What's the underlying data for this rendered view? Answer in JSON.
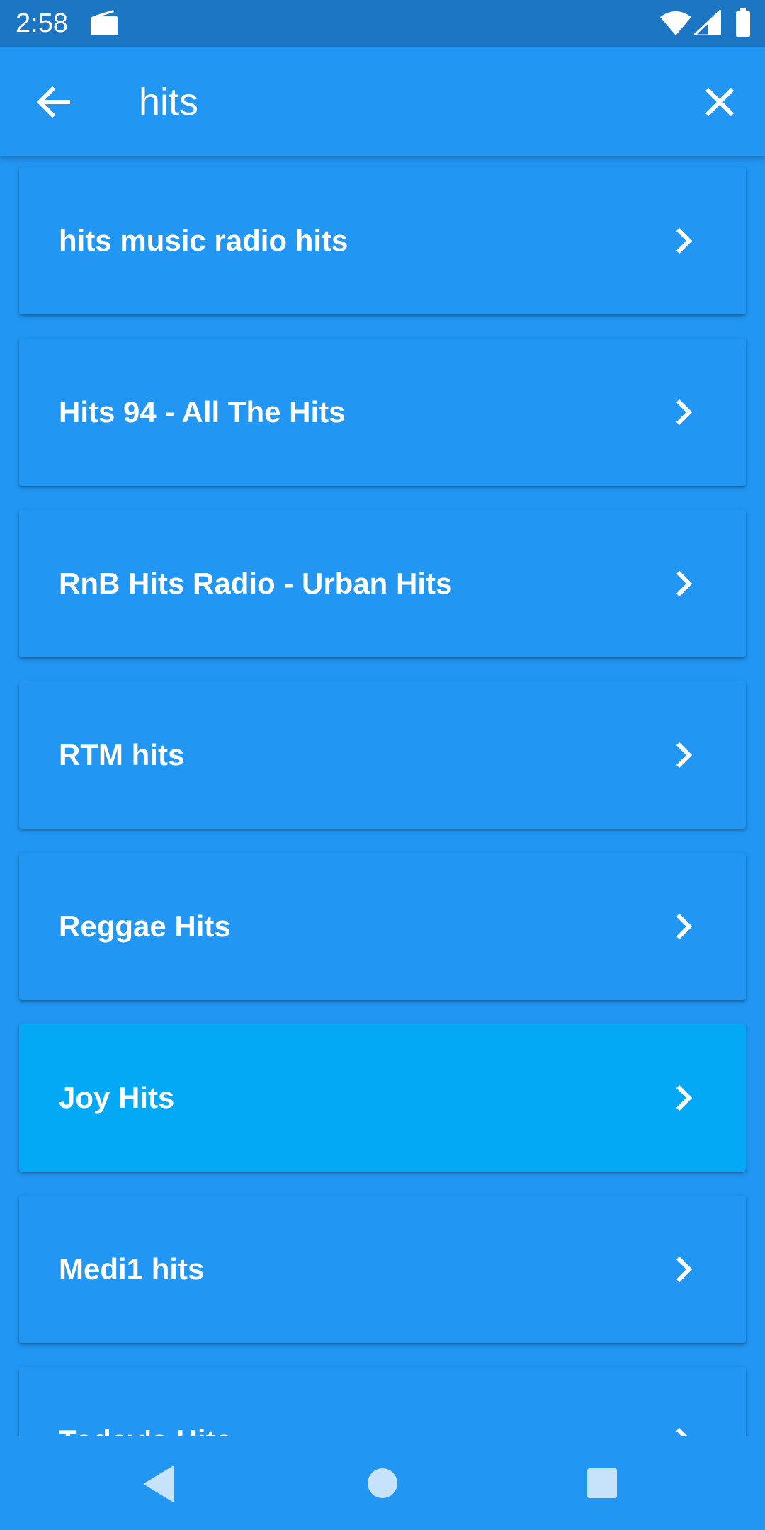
{
  "status_bar": {
    "time": "2:58",
    "icons": [
      "radio-icon",
      "wifi-icon",
      "signal-icon",
      "battery-icon"
    ]
  },
  "toolbar": {
    "back_icon": "arrow-left-icon",
    "search_value": "hits",
    "clear_icon": "close-icon"
  },
  "results": [
    {
      "label": "hits music radio hits",
      "selected": false
    },
    {
      "label": "Hits 94 - All The Hits",
      "selected": false
    },
    {
      "label": "RnB Hits Radio - Urban Hits",
      "selected": false
    },
    {
      "label": "RTM hits",
      "selected": false
    },
    {
      "label": "Reggae Hits",
      "selected": false
    },
    {
      "label": "Joy Hits",
      "selected": true
    },
    {
      "label": "Medi1 hits",
      "selected": false
    },
    {
      "label": "Today's Hits",
      "selected": false
    }
  ],
  "colors": {
    "primary": "#2196F3",
    "status_bar": "#1C76C4",
    "selected_card": "#03A9F4",
    "text": "#FFFFFF"
  },
  "nav_bar": {
    "icons": [
      "nav-back-icon",
      "nav-home-icon",
      "nav-recents-icon"
    ]
  }
}
